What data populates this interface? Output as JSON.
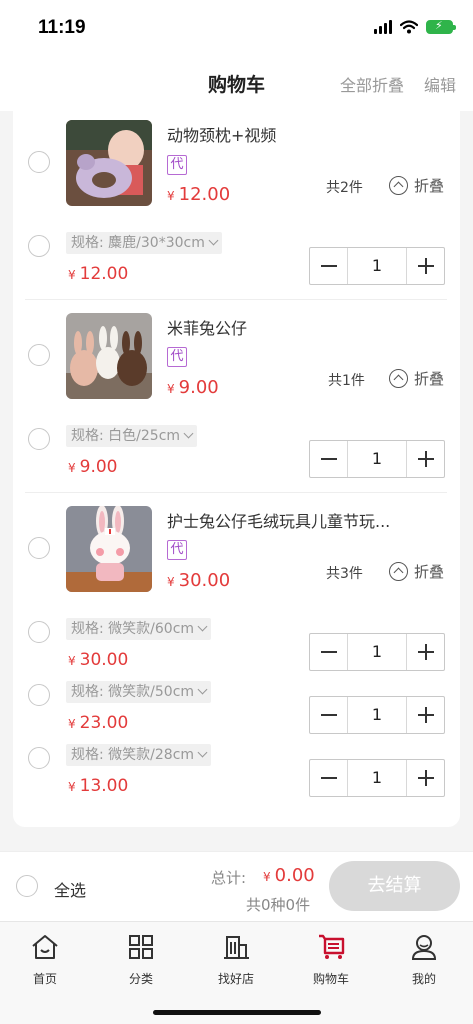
{
  "status_bar": {
    "time": "11:19"
  },
  "header": {
    "title": "购物车",
    "fold_all": "全部折叠",
    "edit": "编辑"
  },
  "products": [
    {
      "name": "动物颈枕+视频",
      "badge": "代",
      "price": "12.00",
      "count_text": "共2件",
      "fold_label": "折叠",
      "skus": [
        {
          "spec": "规格: 麋鹿/30*30cm",
          "price": "12.00",
          "qty": "1"
        }
      ]
    },
    {
      "name": "米菲兔公仔",
      "badge": "代",
      "price": "9.00",
      "count_text": "共1件",
      "fold_label": "折叠",
      "skus": [
        {
          "spec": "规格: 白色/25cm",
          "price": "9.00",
          "qty": "1"
        }
      ]
    },
    {
      "name": "护士兔公仔毛绒玩具儿童节玩...",
      "badge": "代",
      "price": "30.00",
      "count_text": "共3件",
      "fold_label": "折叠",
      "skus": [
        {
          "spec": "规格: 微笑款/60cm",
          "price": "30.00",
          "qty": "1"
        },
        {
          "spec": "规格: 微笑款/50cm",
          "price": "23.00",
          "qty": "1"
        },
        {
          "spec": "规格: 微笑款/28cm",
          "price": "13.00",
          "qty": "1"
        }
      ]
    }
  ],
  "currency_symbol": "¥",
  "footer": {
    "select_all": "全选",
    "total_label": "总计:",
    "total_value": "0.00",
    "summary": "共0种0件",
    "checkout": "去结算"
  },
  "tabbar": [
    {
      "label": "首页",
      "icon": "home-icon"
    },
    {
      "label": "分类",
      "icon": "grid-icon"
    },
    {
      "label": "找好店",
      "icon": "store-icon"
    },
    {
      "label": "购物车",
      "icon": "cart-icon",
      "active": true
    },
    {
      "label": "我的",
      "icon": "user-icon"
    }
  ],
  "colors": {
    "price": "#e33b3b",
    "badge": "#a24dc8",
    "active_tab": "#c8102e",
    "checkout_disabled": "#d9d9d9"
  }
}
